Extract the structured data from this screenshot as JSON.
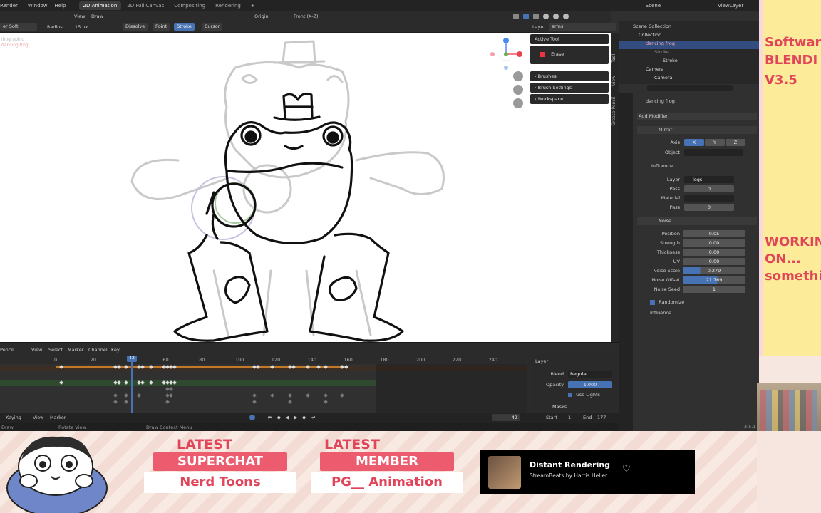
{
  "topbar": {
    "menus": [
      "Render",
      "Window",
      "Help"
    ],
    "workspaces": [
      "2D Animation",
      "2D Full Canvas",
      "Compositing",
      "Rendering"
    ],
    "active_workspace": "2D Animation",
    "add_workspace": "+",
    "scene_label": "Scene",
    "viewlayer_label": "ViewLayer"
  },
  "header2": {
    "view": "View",
    "draw": "Draw",
    "origin": "Origin",
    "front_view": "Front (X-Z)"
  },
  "header3": {
    "brush": "er Soft",
    "radius_label": "Radius",
    "radius_value": "15 px",
    "dissolve": "Dissolve",
    "point": "Point",
    "stroke": "Stroke",
    "cursor": "Cursor",
    "layer_label": "Layer",
    "layer_value": "arms"
  },
  "viewport": {
    "overlay_line1": "ıhographic",
    "overlay_line2": "dancing frog"
  },
  "npanel": {
    "active_tool": "Active Tool",
    "tool_name": "Erase",
    "brushes": "Brushes",
    "brush_settings": "Brush Settings",
    "workspace": "Workspace",
    "tabs": [
      "Tool",
      "View",
      "Grease Pencil"
    ]
  },
  "outliner": {
    "items": [
      {
        "label": "Scene Collection"
      },
      {
        "label": "Collection"
      },
      {
        "label": "dancing frog"
      },
      {
        "label": "Stroke"
      },
      {
        "label": "Stroke"
      },
      {
        "label": "Camera"
      },
      {
        "label": "Camera"
      }
    ]
  },
  "properties": {
    "object_name": "dancing frog",
    "add_modifier": "Add Modifier",
    "mirror": {
      "name": "Mirror",
      "axis_label": "Axis",
      "axes": [
        "X",
        "Y",
        "Z"
      ],
      "object_label": "Object",
      "influence": "Influence",
      "layer_label": "Layer",
      "layer_value": "legs",
      "pass_label": "Pass",
      "pass_value": "0",
      "material_label": "Material",
      "pass2_value": "0"
    },
    "noise": {
      "name": "Noise",
      "rows": [
        {
          "label": "Position",
          "value": "0.05"
        },
        {
          "label": "Strength",
          "value": "0.00"
        },
        {
          "label": "Thickness",
          "value": "0.00"
        },
        {
          "label": "UV",
          "value": "0.00"
        },
        {
          "label": "Noise Scale",
          "value": "0.279",
          "fill": 0.28
        },
        {
          "label": "Noise Offset",
          "value": "21.769",
          "fill": 0.55
        },
        {
          "label": "Noise Seed",
          "value": "1"
        }
      ],
      "randomize": "Randomize",
      "influence": "Influence"
    }
  },
  "timeline": {
    "header": [
      "Pencil",
      "View",
      "Select",
      "Marker",
      "Channel",
      "Key"
    ],
    "ticks": [
      "0",
      "20",
      "40",
      "60",
      "80",
      "100",
      "120",
      "140",
      "160",
      "180",
      "200",
      "220",
      "240"
    ],
    "current_frame_marker": "42",
    "layer_panel": {
      "title": "Layer",
      "blend_label": "Blend",
      "blend_value": "Regular",
      "opacity_label": "Opacity",
      "opacity_value": "1.000",
      "use_lights": "Use Lights",
      "masks": "Masks"
    },
    "playback": {
      "keying": "Keying",
      "view": "View",
      "marker": "Marker",
      "current_frame": "42",
      "start_label": "Start",
      "start_value": "1",
      "end_label": "End",
      "end_value": "177"
    },
    "status": {
      "left": "Draw",
      "rotate": "Rotate View",
      "context": "Draw Context Menu",
      "version": "3.5.1"
    }
  },
  "sticky": {
    "line1": "Softwar",
    "line2": "BLENDI",
    "line3": "V3.5",
    "line4": "WORKIN",
    "line5": "ON...",
    "line6": "somethi"
  },
  "stream": {
    "latest1": "LATEST",
    "superchat": "SUPERCHAT",
    "superchat_name": "Nerd Toons",
    "latest2": "LATEST",
    "member": "MEMBER",
    "member_name": "PG__ Animation",
    "song_title": "Distant Rendering",
    "song_artist": "StreamBeats by Harris Heller"
  }
}
